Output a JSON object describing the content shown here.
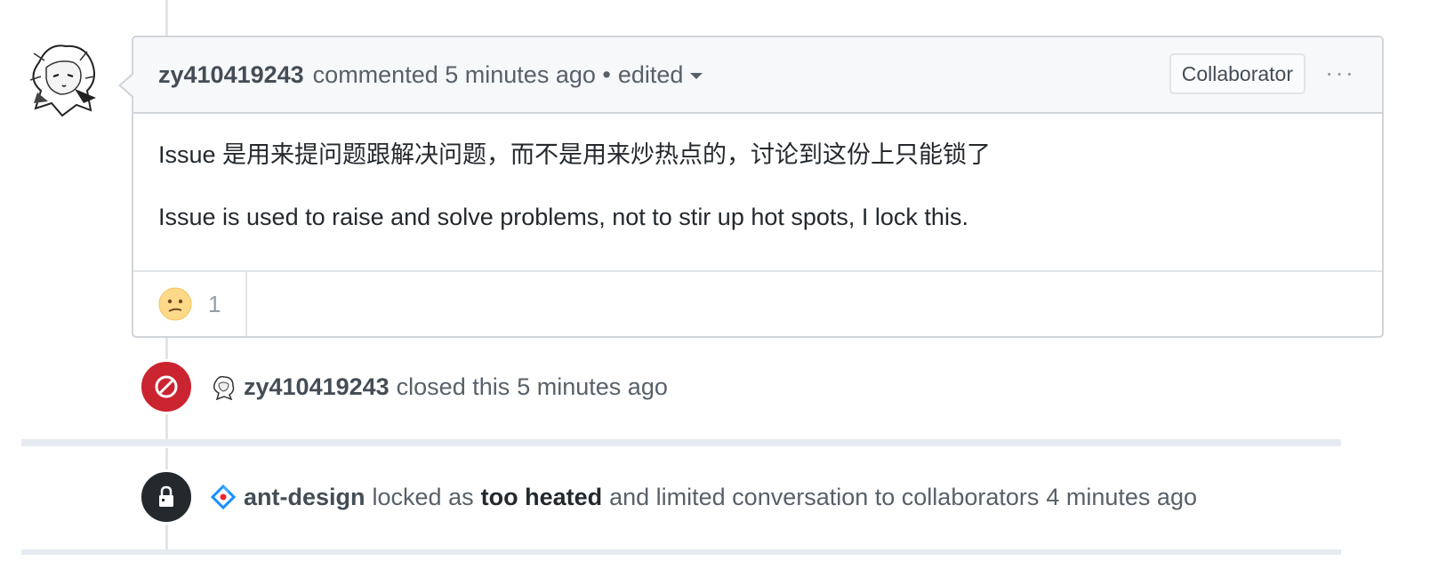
{
  "comment": {
    "author": "zy410419243",
    "action": "commented",
    "time": "5 minutes ago",
    "separator": "•",
    "edited": "edited",
    "badge": "Collaborator",
    "menu": "···",
    "body_zh": "Issue 是用来提问题跟解决问题，而不是用来炒热点的，讨论到这份上只能锁了",
    "body_en": "Issue is used to raise and solve problems, not to stir up hot spots, I lock this.",
    "reaction": {
      "icon": "confused-face-icon",
      "count": "1"
    }
  },
  "events": [
    {
      "icon": "closed-icon",
      "author": "zy410419243",
      "text": "closed this",
      "time": "5 minutes ago",
      "color": "#cb2431"
    },
    {
      "icon": "lock-icon",
      "author": "ant-design",
      "text": "locked as",
      "reason": "too heated",
      "text2": "and limited conversation to collaborators",
      "time": "4 minutes ago",
      "color": "#24292e"
    }
  ]
}
